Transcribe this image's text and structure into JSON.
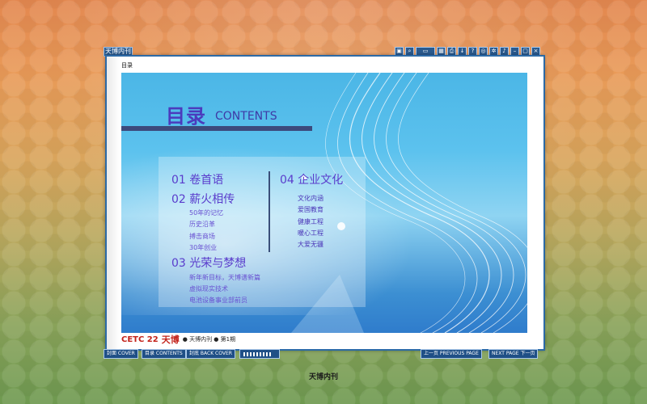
{
  "window": {
    "title": "天博内刊"
  },
  "toolbar": {
    "icons": [
      "book-icon",
      "search-icon",
      "zoom-icon",
      "thumbnails-icon",
      "print-icon",
      "download-icon",
      "help-icon",
      "share-icon",
      "settings-icon",
      "sound-icon",
      "minimize-icon",
      "restore-icon",
      "close-icon"
    ]
  },
  "page_header": {
    "label": "目录"
  },
  "contents": {
    "title_zh": "目录",
    "title_en": "CONTENTS",
    "sections": [
      {
        "title": "01 卷首语",
        "items": []
      },
      {
        "title": "02 薪火相传",
        "items": [
          "50年的记忆",
          "历史沿革",
          "搏击商场",
          "30年创业"
        ]
      },
      {
        "title": "03 光荣与梦想",
        "items": [
          "新年新目标，天博谱新篇",
          "虚拟现实技术",
          "电池设备事业部前员"
        ]
      },
      {
        "title": "04 企业文化",
        "items": [
          "文化内涵",
          "爱国教育",
          "健康工程",
          "暖心工程",
          "大爱无疆"
        ]
      }
    ]
  },
  "footer": {
    "logo_cetc": "CETC 22",
    "logo_tb": "天博",
    "text": "● 天博内刊 ● 第1期"
  },
  "nav": {
    "cover": "封面 COVER",
    "contents": "目录 CONTENTS",
    "back_cover": "封底 BACK COVER",
    "previous": "上一页 PREVIOUS PAGE",
    "next": "NEXT PAGE 下一页"
  },
  "bottom_title": "天博内刊"
}
